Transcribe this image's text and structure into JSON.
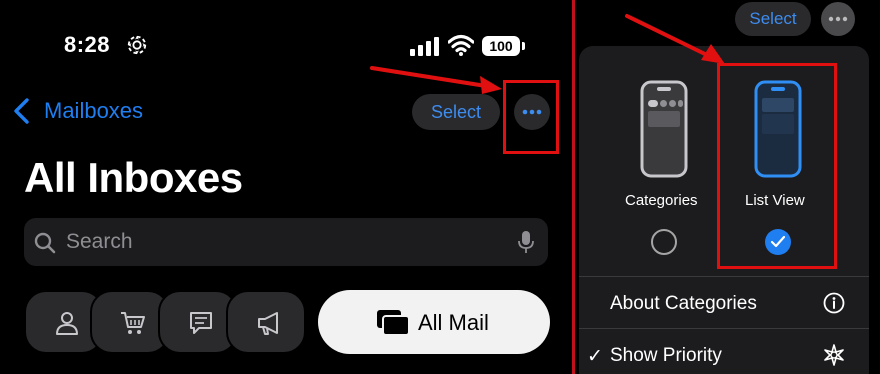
{
  "status_bar": {
    "time": "8:28",
    "battery": "100"
  },
  "nav": {
    "back_label": "Mailboxes",
    "select_label": "Select"
  },
  "page_title": "All Inboxes",
  "search": {
    "placeholder": "Search"
  },
  "filters": {
    "all_mail_label": "All Mail"
  },
  "menu": {
    "select_label": "Select",
    "views": [
      {
        "label": "Categories",
        "selected": false
      },
      {
        "label": "List View",
        "selected": true
      }
    ],
    "rows": [
      {
        "label": "About Categories",
        "icon": "info-icon"
      },
      {
        "label": "Show Priority",
        "icon": "sparkle-icon",
        "checked": true
      }
    ]
  },
  "colors": {
    "accent": "#1f7ef0",
    "highlight": "#e01010",
    "background": "#000000",
    "surface": "#1c1c1e"
  }
}
